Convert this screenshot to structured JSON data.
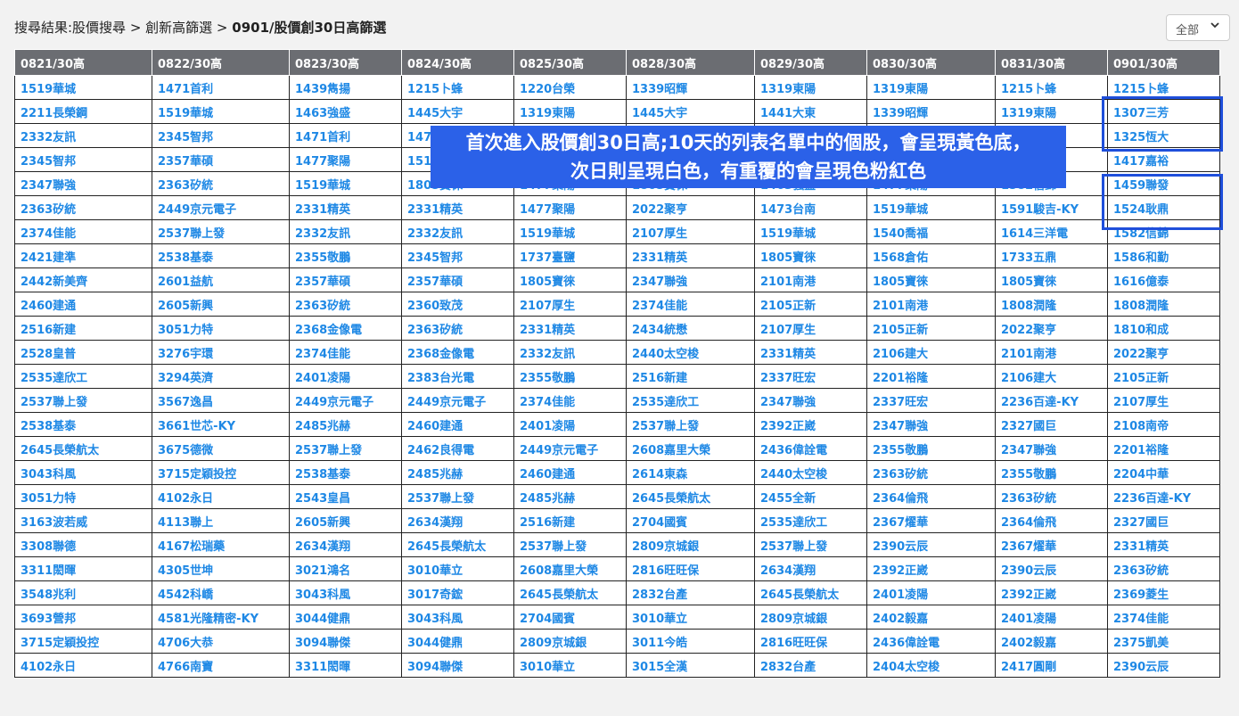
{
  "breadcrumb": {
    "prefix": "搜尋結果:股價搜尋 > 創新高篩選 > ",
    "current": "0901/股價創30日高篩選"
  },
  "filter": {
    "label": "全部",
    "chevron_icon": "chevron-down-icon"
  },
  "colors": {
    "header_bg": "#6b6d72",
    "text": "#1e88e5",
    "repeat_pink": "#f2a9b1",
    "new_yellow": "#fbfb8f",
    "highlight_border": "#1f4fdb",
    "callout_bg": "#2b61e8"
  },
  "callout": {
    "line1": "首次進入股價創30日高;10天的列表名單中的個股，會呈現黃色底，",
    "line2": "次日則呈現白色，有重覆的會呈現色粉紅色"
  },
  "table": {
    "headers": [
      "0821/30高",
      "0822/30高",
      "0823/30高",
      "0824/30高",
      "0825/30高",
      "0828/30高",
      "0829/30高",
      "0830/30高",
      "0831/30高",
      "0901/30高"
    ],
    "rows": [
      [
        [
          "1519華城",
          "w"
        ],
        [
          "1471首利",
          "w"
        ],
        [
          "1439雋揚",
          "w"
        ],
        [
          "1215卜蜂",
          "w"
        ],
        [
          "1220台榮",
          "w"
        ],
        [
          "1339昭輝",
          "w"
        ],
        [
          "1319東陽",
          "p"
        ],
        [
          "1319東陽",
          "p"
        ],
        [
          "1215卜蜂",
          "p"
        ],
        [
          "1215卜蜂",
          "p"
        ]
      ],
      [
        [
          "2211長榮鋼",
          "w"
        ],
        [
          "1519華城",
          "p"
        ],
        [
          "1463強盛",
          "w"
        ],
        [
          "1445大宇",
          "w"
        ],
        [
          "1319東陽",
          "w"
        ],
        [
          "1445大宇",
          "p"
        ],
        [
          "1441大東",
          "w"
        ],
        [
          "1339昭輝",
          "p"
        ],
        [
          "1319東陽",
          "p"
        ],
        [
          "1307三芳",
          "y"
        ]
      ],
      [
        [
          "2332友訊",
          "g"
        ],
        [
          "2345智邦",
          "pd"
        ],
        [
          "1471首利",
          "pd"
        ],
        [
          "1477聚陽",
          "pd"
        ],
        [
          "",
          "w"
        ],
        [
          "",
          "w"
        ],
        [
          "",
          "w"
        ],
        [
          "",
          "w"
        ],
        [
          "",
          "w"
        ],
        [
          "1325恆大",
          "yd"
        ]
      ],
      [
        [
          "2345智邦",
          "w"
        ],
        [
          "2357華碩",
          "w"
        ],
        [
          "1477聚陽",
          "w"
        ],
        [
          "1519華城",
          "w"
        ],
        [
          "",
          "w"
        ],
        [
          "",
          "w"
        ],
        [
          "",
          "w"
        ],
        [
          "",
          "w"
        ],
        [
          "",
          "p"
        ],
        [
          "1417嘉裕",
          "p"
        ]
      ],
      [
        [
          "2347聯強",
          "w"
        ],
        [
          "2363矽統",
          "p"
        ],
        [
          "1519華城",
          "p"
        ],
        [
          "1805寶徠",
          "w"
        ],
        [
          "1477聚陽",
          "p"
        ],
        [
          "1805寶徠",
          "p"
        ],
        [
          "1463強盛",
          "p"
        ],
        [
          "1477聚陽",
          "p"
        ],
        [
          "1582信錦",
          "p"
        ],
        [
          "1459聯發",
          "y"
        ]
      ],
      [
        [
          "2363矽統",
          "w"
        ],
        [
          "2449京元電子",
          "w"
        ],
        [
          "2331精英",
          "w"
        ],
        [
          "2331精英",
          "p"
        ],
        [
          "1477聚陽",
          "p"
        ],
        [
          "2022聚亨",
          "w"
        ],
        [
          "1473台南",
          "w"
        ],
        [
          "1519華城",
          "p"
        ],
        [
          "1591駿吉-KY",
          "w"
        ],
        [
          "1524耿鼎",
          "y"
        ]
      ],
      [
        [
          "2374佳能",
          "w"
        ],
        [
          "2537聯上發",
          "p"
        ],
        [
          "2332友訊",
          "p"
        ],
        [
          "2332友訊",
          "p"
        ],
        [
          "1519華城",
          "p"
        ],
        [
          "2107厚生",
          "p"
        ],
        [
          "1519華城",
          "p"
        ],
        [
          "1540喬福",
          "w"
        ],
        [
          "1614三洋電",
          "w"
        ],
        [
          "1582信錦",
          "p"
        ]
      ],
      [
        [
          "2421建準",
          "w"
        ],
        [
          "2538基泰",
          "p"
        ],
        [
          "2355敬鵬",
          "w"
        ],
        [
          "2345智邦",
          "p"
        ],
        [
          "1737臺鹽",
          "w"
        ],
        [
          "2331精英",
          "p"
        ],
        [
          "1805寶徠",
          "p"
        ],
        [
          "1568倉佑",
          "w"
        ],
        [
          "1733五鼎",
          "w"
        ],
        [
          "1586和勤",
          "y"
        ]
      ],
      [
        [
          "2442新美齊",
          "w"
        ],
        [
          "2601益航",
          "w"
        ],
        [
          "2357華碩",
          "p"
        ],
        [
          "2357華碩",
          "p"
        ],
        [
          "1805寶徠",
          "p"
        ],
        [
          "2347聯強",
          "p"
        ],
        [
          "2101南港",
          "w"
        ],
        [
          "1805寶徠",
          "p"
        ],
        [
          "1805寶徠",
          "p"
        ],
        [
          "1616億泰",
          "y"
        ]
      ],
      [
        [
          "2460建通",
          "w"
        ],
        [
          "2605新興",
          "w"
        ],
        [
          "2363矽統",
          "p"
        ],
        [
          "2360致茂",
          "w"
        ],
        [
          "2107厚生",
          "w"
        ],
        [
          "2374佳能",
          "p"
        ],
        [
          "2105正新",
          "w"
        ],
        [
          "2101南港",
          "p"
        ],
        [
          "1808潤隆",
          "w"
        ],
        [
          "1808潤隆",
          "p"
        ]
      ],
      [
        [
          "2516新建",
          "w"
        ],
        [
          "3051力特",
          "p"
        ],
        [
          "2368金像電",
          "w"
        ],
        [
          "2363矽統",
          "p"
        ],
        [
          "2331精英",
          "p"
        ],
        [
          "2434統懋",
          "w"
        ],
        [
          "2107厚生",
          "p"
        ],
        [
          "2105正新",
          "p"
        ],
        [
          "2022聚亨",
          "p"
        ],
        [
          "1810和成",
          "y"
        ]
      ],
      [
        [
          "2528皇普",
          "w"
        ],
        [
          "3276宇環",
          "w"
        ],
        [
          "2374佳能",
          "p"
        ],
        [
          "2368金像電",
          "p"
        ],
        [
          "2332友訊",
          "p"
        ],
        [
          "2440太空梭",
          "w"
        ],
        [
          "2331精英",
          "p"
        ],
        [
          "2106建大",
          "w"
        ],
        [
          "2101南港",
          "p"
        ],
        [
          "2022聚亨",
          "p"
        ]
      ],
      [
        [
          "2535達欣工",
          "w"
        ],
        [
          "3294英濟",
          "w"
        ],
        [
          "2401凌陽",
          "w"
        ],
        [
          "2383台光電",
          "w"
        ],
        [
          "2355敬鵬",
          "p"
        ],
        [
          "2516新建",
          "p"
        ],
        [
          "2337旺宏",
          "w"
        ],
        [
          "2201裕隆",
          "w"
        ],
        [
          "2106建大",
          "p"
        ],
        [
          "2105正新",
          "p"
        ]
      ],
      [
        [
          "2537聯上發",
          "w"
        ],
        [
          "3567逸昌",
          "w"
        ],
        [
          "2449京元電子",
          "p"
        ],
        [
          "2449京元電子",
          "p"
        ],
        [
          "2374佳能",
          "p"
        ],
        [
          "2535達欣工",
          "p"
        ],
        [
          "2347聯強",
          "p"
        ],
        [
          "2337旺宏",
          "p"
        ],
        [
          "2236百達-KY",
          "w"
        ],
        [
          "2107厚生",
          "p"
        ]
      ],
      [
        [
          "2538基泰",
          "w"
        ],
        [
          "3661世芯-KY",
          "w"
        ],
        [
          "2485兆赫",
          "w"
        ],
        [
          "2460建通",
          "p"
        ],
        [
          "2401凌陽",
          "p"
        ],
        [
          "2537聯上發",
          "p"
        ],
        [
          "2392正崴",
          "w"
        ],
        [
          "2347聯強",
          "p"
        ],
        [
          "2327國巨",
          "w"
        ],
        [
          "2108南帝",
          "y"
        ]
      ],
      [
        [
          "2645長榮航太",
          "w"
        ],
        [
          "3675德微",
          "w"
        ],
        [
          "2537聯上發",
          "p"
        ],
        [
          "2462良得電",
          "w"
        ],
        [
          "2449京元電子",
          "p"
        ],
        [
          "2608嘉里大榮",
          "p"
        ],
        [
          "2436偉詮電",
          "w"
        ],
        [
          "2355敬鵬",
          "p"
        ],
        [
          "2347聯強",
          "p"
        ],
        [
          "2201裕隆",
          "p"
        ]
      ],
      [
        [
          "3043科風",
          "w"
        ],
        [
          "3715定穎投控",
          "p"
        ],
        [
          "2538基泰",
          "p"
        ],
        [
          "2485兆赫",
          "p"
        ],
        [
          "2460建通",
          "p"
        ],
        [
          "2614東森",
          "w"
        ],
        [
          "2440太空梭",
          "p"
        ],
        [
          "2363矽統",
          "p"
        ],
        [
          "2355敬鵬",
          "p"
        ],
        [
          "2204中華",
          "y"
        ]
      ],
      [
        [
          "3051力特",
          "w"
        ],
        [
          "4102永日",
          "p"
        ],
        [
          "2543皇昌",
          "w"
        ],
        [
          "2537聯上發",
          "p"
        ],
        [
          "2485兆赫",
          "p"
        ],
        [
          "2645長榮航太",
          "p"
        ],
        [
          "2455全新",
          "w"
        ],
        [
          "2364倫飛",
          "w"
        ],
        [
          "2363矽統",
          "p"
        ],
        [
          "2236百達-KY",
          "p"
        ]
      ],
      [
        [
          "3163波若威",
          "w"
        ],
        [
          "4113聯上",
          "p"
        ],
        [
          "2605新興",
          "p"
        ],
        [
          "2634漢翔",
          "p"
        ],
        [
          "2516新建",
          "p"
        ],
        [
          "2704國賓",
          "p"
        ],
        [
          "2535達欣工",
          "p"
        ],
        [
          "2367燿華",
          "w"
        ],
        [
          "2364倫飛",
          "p"
        ],
        [
          "2327國巨",
          "p"
        ]
      ],
      [
        [
          "3308聯德",
          "w"
        ],
        [
          "4167松瑞藥",
          "w"
        ],
        [
          "2634漢翔",
          "w"
        ],
        [
          "2645長榮航太",
          "p"
        ],
        [
          "2537聯上發",
          "p"
        ],
        [
          "2809京城銀",
          "w"
        ],
        [
          "2537聯上發",
          "p"
        ],
        [
          "2390云辰",
          "w"
        ],
        [
          "2367燿華",
          "p"
        ],
        [
          "2331精英",
          "p"
        ]
      ],
      [
        [
          "3311閎暉",
          "w"
        ],
        [
          "4305世坤",
          "w"
        ],
        [
          "3021鴻名",
          "w"
        ],
        [
          "3010華立",
          "w"
        ],
        [
          "2608嘉里大榮",
          "p"
        ],
        [
          "2816旺旺保",
          "w"
        ],
        [
          "2634漢翔",
          "p"
        ],
        [
          "2392正崴",
          "p"
        ],
        [
          "2390云辰",
          "p"
        ],
        [
          "2363矽統",
          "p"
        ]
      ],
      [
        [
          "3548兆利",
          "w"
        ],
        [
          "4542科嶠",
          "p"
        ],
        [
          "3043科風",
          "p"
        ],
        [
          "3017奇鋐",
          "w"
        ],
        [
          "2645長榮航太",
          "p"
        ],
        [
          "2832台產",
          "w"
        ],
        [
          "2645長榮航太",
          "p"
        ],
        [
          "2401凌陽",
          "p"
        ],
        [
          "2392正崴",
          "p"
        ],
        [
          "2369菱生",
          "y"
        ]
      ],
      [
        [
          "3693營邦",
          "w"
        ],
        [
          "4581光隆精密-KY",
          "w"
        ],
        [
          "3044健鼎",
          "w"
        ],
        [
          "3043科風",
          "p"
        ],
        [
          "2704國賓",
          "w"
        ],
        [
          "3010華立",
          "p"
        ],
        [
          "2809京城銀",
          "p"
        ],
        [
          "2402毅嘉",
          "w"
        ],
        [
          "2401凌陽",
          "p"
        ],
        [
          "2374佳能",
          "p"
        ]
      ],
      [
        [
          "3715定穎投控",
          "w"
        ],
        [
          "4706大恭",
          "p"
        ],
        [
          "3094聯傑",
          "w"
        ],
        [
          "3044健鼎",
          "p"
        ],
        [
          "2809京城銀",
          "w"
        ],
        [
          "3011今皓",
          "w"
        ],
        [
          "2816旺旺保",
          "p"
        ],
        [
          "2436偉詮電",
          "p"
        ],
        [
          "2402毅嘉",
          "p"
        ],
        [
          "2375凱美",
          "y"
        ]
      ],
      [
        [
          "4102永日",
          "w"
        ],
        [
          "4766南寶",
          "p"
        ],
        [
          "3311閎暉",
          "p"
        ],
        [
          "3094聯傑",
          "p"
        ],
        [
          "3010華立",
          "p"
        ],
        [
          "3015全漢",
          "w"
        ],
        [
          "2832台產",
          "p"
        ],
        [
          "2404太空梭",
          "p"
        ],
        [
          "2417圓剛",
          "w"
        ],
        [
          "2390云辰",
          "p"
        ]
      ]
    ]
  }
}
